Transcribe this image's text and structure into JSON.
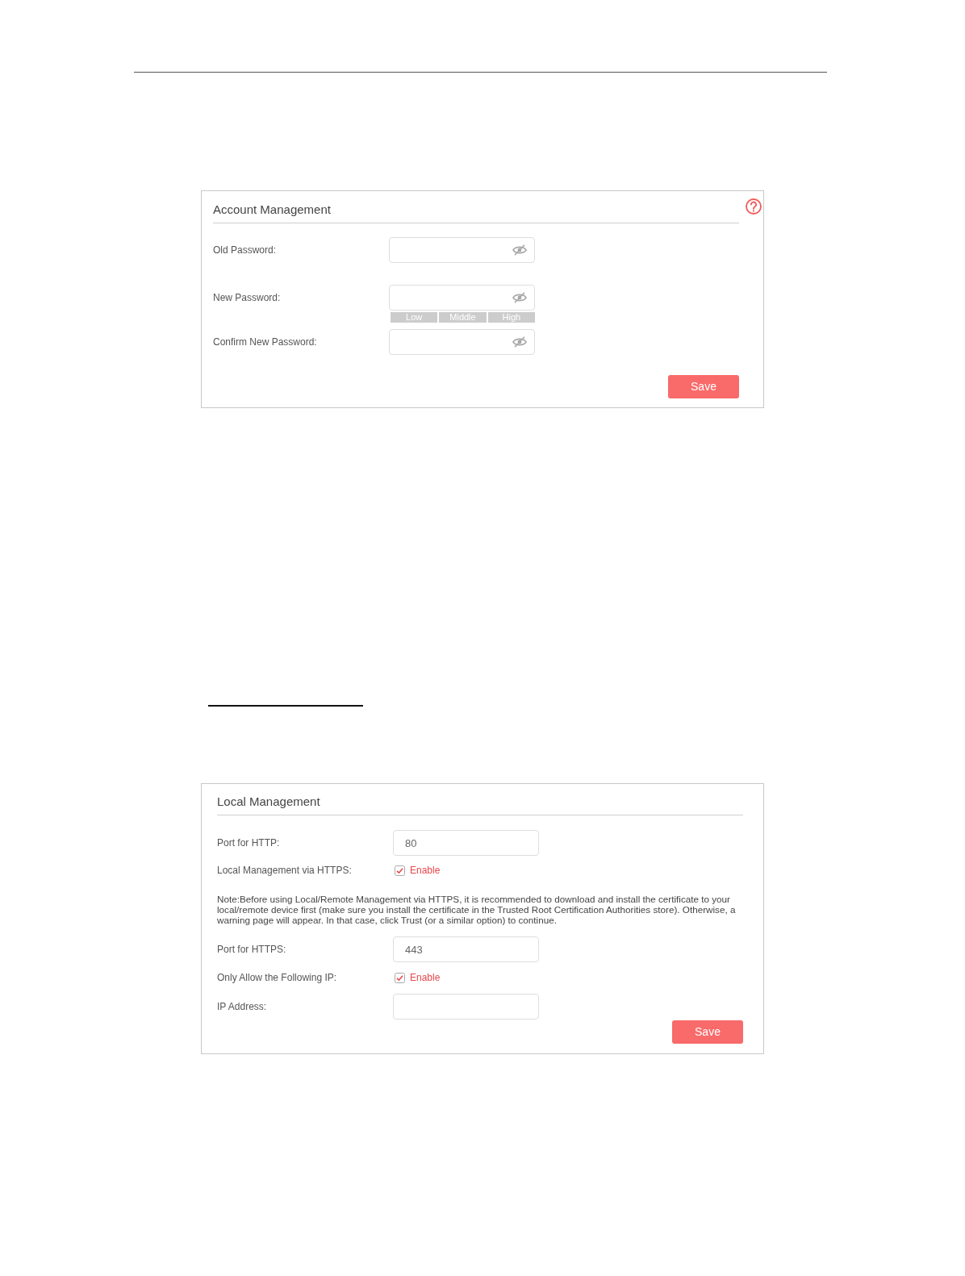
{
  "account_management": {
    "title": "Account Management",
    "rows": [
      {
        "kind": "password",
        "label": "Old Password:"
      },
      {
        "kind": "password",
        "label": "New Password:",
        "strength_meter": [
          {
            "label": "Low",
            "lit": false
          },
          {
            "label": "Middle",
            "lit": false
          },
          {
            "label": "High",
            "lit": false
          }
        ]
      },
      {
        "kind": "password",
        "label": "Confirm New Password:"
      }
    ],
    "save_button": "Save"
  },
  "local_management": {
    "title": "Local Management",
    "rows": [
      {
        "kind": "text",
        "label": "Port for HTTP:",
        "value": "80"
      },
      {
        "kind": "checkbox",
        "label": "Local Management via HTTPS:",
        "option": "Enable",
        "checked": true
      },
      {
        "kind": "note",
        "text": "Note:Before using Local/Remote Management via HTTPS, it is recommended to download and install the certificate to your local/remote device first (make sure you install the certificate in the Trusted Root Certification Authorities store). Otherwise, a warning page will appear. In that case, click Trust (or a similar option) to continue."
      },
      {
        "kind": "text",
        "label": "Port for HTTPS:",
        "value": "443"
      },
      {
        "kind": "checkbox",
        "label": "Only Allow the Following IP:",
        "option": "Enable",
        "checked": true
      },
      {
        "kind": "text",
        "label": "IP Address:"
      }
    ],
    "save_button": "Save"
  }
}
